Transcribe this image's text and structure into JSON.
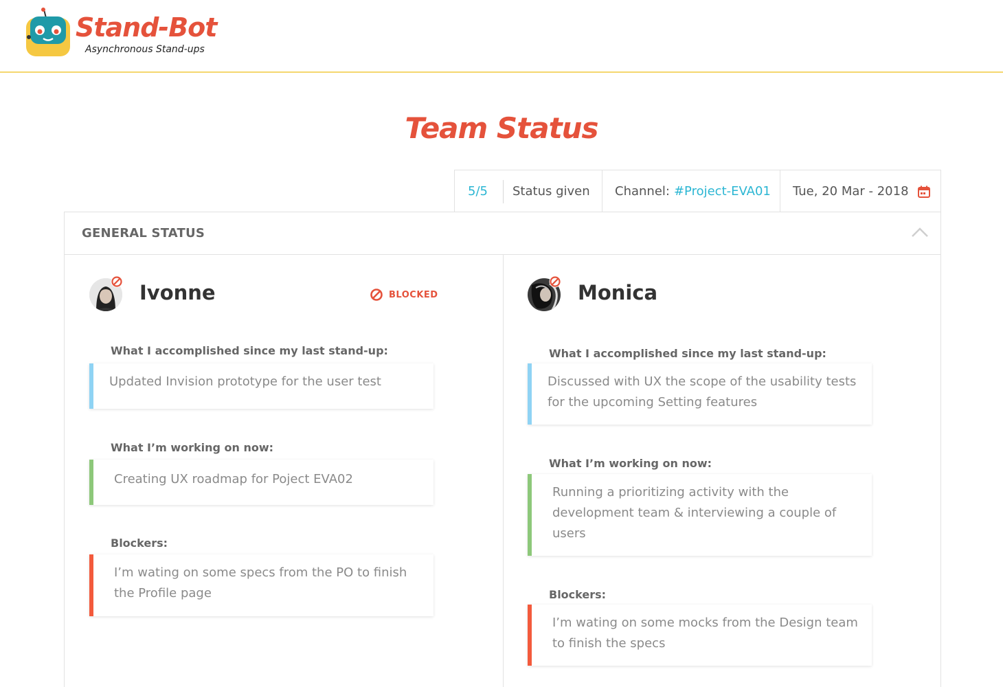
{
  "brand": {
    "title": "Stand-Bot",
    "tagline": "Asynchronous Stand-ups",
    "colors": {
      "accent": "#e5523b",
      "link": "#2bb6d3",
      "header_rule": "#f5d76e"
    }
  },
  "page": {
    "title": "Team Status"
  },
  "info_bar": {
    "count": "5/5",
    "given_label": "Status given",
    "channel_label": "Channel:",
    "channel_value": "#Project-EVA01",
    "date": "Tue, 20 Mar - 2018",
    "calendar_icon": "calendar-icon"
  },
  "panel": {
    "title": "GENERAL STATUS",
    "collapse_icon": "chevron-up-icon"
  },
  "members": [
    {
      "name": "Ivonne",
      "status_badge": "BLOCKED",
      "accomplished_label": "What I accomplished since my last stand-up:",
      "accomplished": "Updated Invision prototype for the user test",
      "working_label": "What I’m working on now:",
      "working": "Creating UX roadmap for Poject EVA02",
      "blockers_label": "Blockers:",
      "blockers": "I’m wating on some specs from the PO to finish the  Profile page"
    },
    {
      "name": "Monica",
      "accomplished_label": "What I accomplished since my last stand-up:",
      "accomplished": "Discussed with UX the scope of the usability tests for the upcoming Setting features",
      "working_label": "What I’m working on now:",
      "working": "Running a prioritizing activity with the development team & interviewing a couple of users",
      "blockers_label": "Blockers:",
      "blockers": "I’m wating on some mocks from the Design team to finish the specs"
    }
  ]
}
